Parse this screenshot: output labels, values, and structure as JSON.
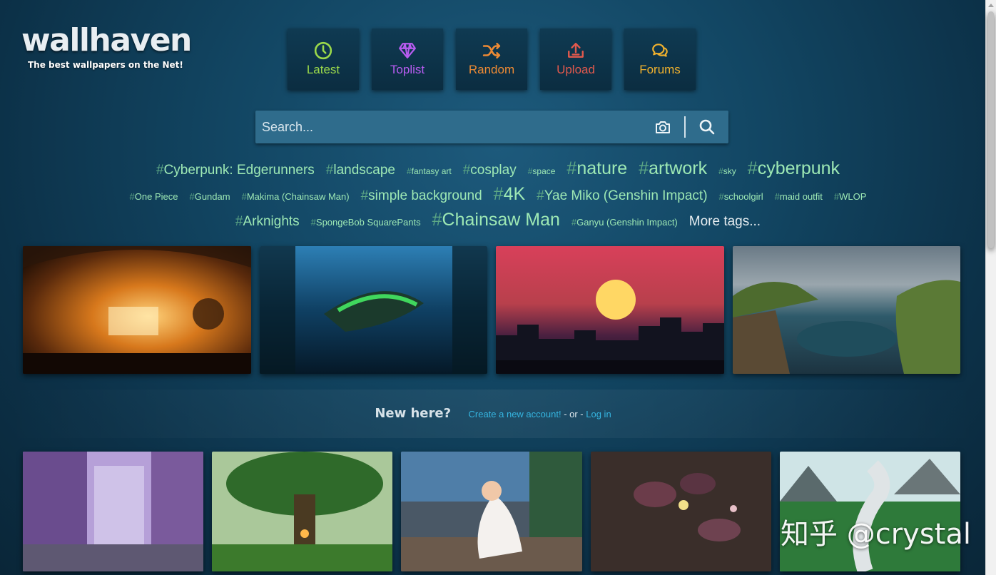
{
  "logo": {
    "name": "wallhaven",
    "tagline": "The best wallpapers on the Net!"
  },
  "nav": [
    {
      "label": "Latest",
      "icon": "clock-icon",
      "color": "#9bd94a"
    },
    {
      "label": "Toplist",
      "icon": "diamond-icon",
      "color": "#b75cf0"
    },
    {
      "label": "Random",
      "icon": "shuffle-icon",
      "color": "#ee8a34"
    },
    {
      "label": "Upload",
      "icon": "upload-icon",
      "color": "#e2594d"
    },
    {
      "label": "Forums",
      "icon": "comments-icon",
      "color": "#f0b12e"
    }
  ],
  "search": {
    "placeholder": "Search..."
  },
  "tags": {
    "row1": [
      {
        "label": "Cyberpunk: Edgerunners",
        "size": "s3"
      },
      {
        "label": "landscape",
        "size": "s3"
      },
      {
        "label": "fantasy art",
        "size": "s1"
      },
      {
        "label": "cosplay",
        "size": "s3"
      },
      {
        "label": "space",
        "size": "s1"
      },
      {
        "label": "nature",
        "size": "s4"
      },
      {
        "label": "artwork",
        "size": "s4"
      },
      {
        "label": "sky",
        "size": "s1"
      },
      {
        "label": "cyberpunk",
        "size": "s4"
      }
    ],
    "row2": [
      {
        "label": "One Piece",
        "size": "s2"
      },
      {
        "label": "Gundam",
        "size": "s2"
      },
      {
        "label": "Makima (Chainsaw Man)",
        "size": "s2"
      },
      {
        "label": "simple background",
        "size": "s3"
      },
      {
        "label": "4K",
        "size": "s4"
      },
      {
        "label": "Yae Miko (Genshin Impact)",
        "size": "s3"
      },
      {
        "label": "schoolgirl",
        "size": "s2"
      },
      {
        "label": "maid outfit",
        "size": "s2"
      },
      {
        "label": "WLOP",
        "size": "s2"
      }
    ],
    "row3": [
      {
        "label": "Arknights",
        "size": "s3"
      },
      {
        "label": "SpongeBob SquarePants",
        "size": "s2"
      },
      {
        "label": "Chainsaw Man",
        "size": "s4"
      },
      {
        "label": "Ganyu (Genshin Impact)",
        "size": "s2"
      }
    ],
    "more": "More tags..."
  },
  "welcome": {
    "question": "New here?",
    "create": "Create a new account!",
    "or": " - or - ",
    "login": "Log in"
  },
  "watermark": "知乎 @crystal"
}
